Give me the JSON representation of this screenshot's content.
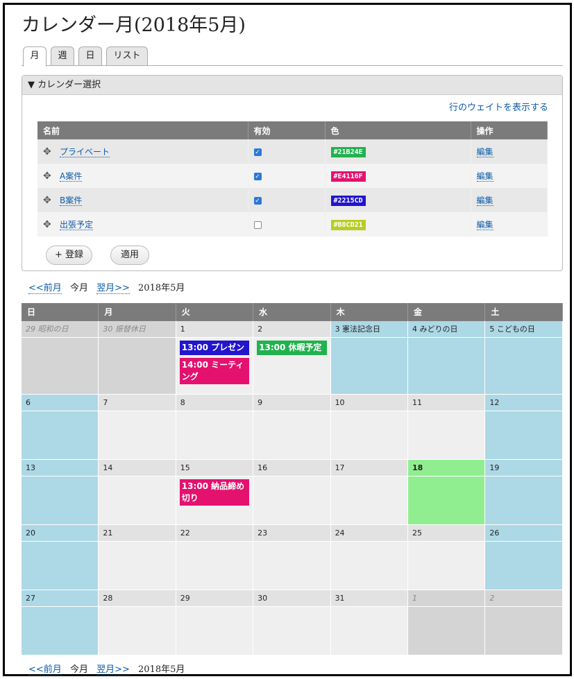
{
  "page": {
    "title": "カレンダー月(2018年5月)"
  },
  "tabs": [
    {
      "label": "月",
      "active": true
    },
    {
      "label": "週",
      "active": false
    },
    {
      "label": "日",
      "active": false
    },
    {
      "label": "リスト",
      "active": false
    }
  ],
  "selector": {
    "legend": "▼ カレンダー選択",
    "show_weights": "行のウェイトを表示する",
    "columns": [
      "名前",
      "有効",
      "色",
      "操作"
    ],
    "rows": [
      {
        "name": "プライベート",
        "enabled": true,
        "color": "#21B24E",
        "op": "編集"
      },
      {
        "name": "A案件",
        "enabled": true,
        "color": "#E4116F",
        "op": "編集"
      },
      {
        "name": "B案件",
        "enabled": true,
        "color": "#2215CD",
        "op": "編集"
      },
      {
        "name": "出張予定",
        "enabled": false,
        "color": "#B8CD21",
        "op": "編集"
      }
    ],
    "add_button": "+ 登録",
    "apply_button": "適用"
  },
  "pager": {
    "prev": "<<前月",
    "current": "今月",
    "next": "翌月>>",
    "month": "2018年5月"
  },
  "calendar": {
    "weekdays": [
      "日",
      "月",
      "火",
      "水",
      "木",
      "金",
      "土"
    ],
    "weeks": [
      [
        {
          "label": "29 昭和の日",
          "type": "other"
        },
        {
          "label": "30 振替休日",
          "type": "other"
        },
        {
          "label": "1",
          "type": "normal",
          "events": [
            {
              "text": "13:00 プレゼン",
              "color": "#2215CD"
            },
            {
              "text": "14:00 ミーティング",
              "color": "#E4116F"
            }
          ]
        },
        {
          "label": "2",
          "type": "normal",
          "events": [
            {
              "text": "13:00 休暇予定",
              "color": "#21B24E"
            }
          ]
        },
        {
          "label": "3 憲法記念日",
          "type": "holiday"
        },
        {
          "label": "4 みどりの日",
          "type": "holiday"
        },
        {
          "label": "5 こどもの日",
          "type": "holiday"
        }
      ],
      [
        {
          "label": "6",
          "type": "holiday"
        },
        {
          "label": "7",
          "type": "normal"
        },
        {
          "label": "8",
          "type": "normal"
        },
        {
          "label": "9",
          "type": "normal"
        },
        {
          "label": "10",
          "type": "normal"
        },
        {
          "label": "11",
          "type": "normal"
        },
        {
          "label": "12",
          "type": "holiday"
        }
      ],
      [
        {
          "label": "13",
          "type": "holiday"
        },
        {
          "label": "14",
          "type": "normal"
        },
        {
          "label": "15",
          "type": "normal",
          "events": [
            {
              "text": "13:00 納品締め切り",
              "color": "#E4116F"
            }
          ]
        },
        {
          "label": "16",
          "type": "normal"
        },
        {
          "label": "17",
          "type": "normal"
        },
        {
          "label": "18",
          "type": "today"
        },
        {
          "label": "19",
          "type": "holiday"
        }
      ],
      [
        {
          "label": "20",
          "type": "holiday"
        },
        {
          "label": "21",
          "type": "normal"
        },
        {
          "label": "22",
          "type": "normal"
        },
        {
          "label": "23",
          "type": "normal"
        },
        {
          "label": "24",
          "type": "normal"
        },
        {
          "label": "25",
          "type": "normal"
        },
        {
          "label": "26",
          "type": "holiday"
        }
      ],
      [
        {
          "label": "27",
          "type": "holiday"
        },
        {
          "label": "28",
          "type": "normal"
        },
        {
          "label": "29",
          "type": "normal"
        },
        {
          "label": "30",
          "type": "normal"
        },
        {
          "label": "31",
          "type": "normal"
        },
        {
          "label": "1",
          "type": "other"
        },
        {
          "label": "2",
          "type": "other"
        }
      ]
    ]
  }
}
